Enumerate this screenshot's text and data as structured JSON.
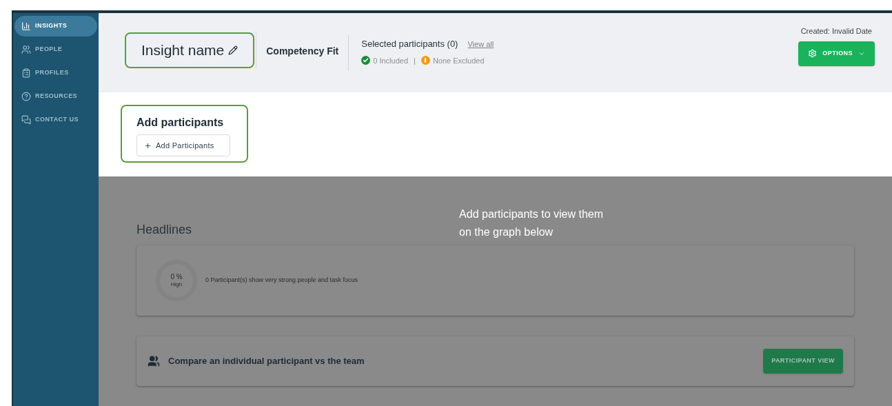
{
  "sidebar": {
    "items": [
      {
        "label": "INSIGHTS",
        "selected": true
      },
      {
        "label": "PEOPLE",
        "selected": false
      },
      {
        "label": "PROFILES",
        "selected": false
      },
      {
        "label": "RESOURCES",
        "selected": false
      },
      {
        "label": "CONTACT US",
        "selected": false
      }
    ]
  },
  "header": {
    "insight_name": "Insight name",
    "type": "Competency Fit",
    "selected_participants": "Selected participants (0)",
    "view_all": "View all",
    "included": "0 Included",
    "separator": "|",
    "excluded": "None Excluded",
    "created": "Created: Invalid Date",
    "options_button": "OPTIONS"
  },
  "add_section": {
    "title": "Add participants",
    "button": "Add Participants"
  },
  "overlay_message": "Add participants to view them on the graph below",
  "headlines": {
    "title": "Headlines",
    "percent": "0 %",
    "percent_label": "High",
    "text": "0 Participant(s) show very strong people and task focus"
  },
  "compare": {
    "text": "Compare an individual participant vs the team",
    "button": "PARTICIPANT VIEW"
  }
}
